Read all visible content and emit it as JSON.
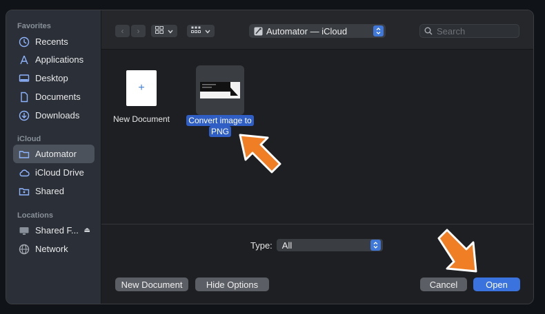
{
  "sidebar": {
    "sections": [
      {
        "title": "Favorites",
        "items": [
          {
            "label": "Recents",
            "icon": "clock-icon"
          },
          {
            "label": "Applications",
            "icon": "applications-icon"
          },
          {
            "label": "Desktop",
            "icon": "desktop-icon"
          },
          {
            "label": "Documents",
            "icon": "document-icon"
          },
          {
            "label": "Downloads",
            "icon": "downloads-icon"
          }
        ]
      },
      {
        "title": "iCloud",
        "items": [
          {
            "label": "Automator",
            "icon": "folder-icon",
            "selected": true
          },
          {
            "label": "iCloud Drive",
            "icon": "cloud-icon"
          },
          {
            "label": "Shared",
            "icon": "shared-folder-icon"
          }
        ]
      },
      {
        "title": "Locations",
        "items": [
          {
            "label": "Shared F...",
            "icon": "display-icon",
            "eject": "⏏"
          },
          {
            "label": "Network",
            "icon": "globe-icon"
          }
        ]
      }
    ]
  },
  "toolbar": {
    "back": "‹",
    "forward": "›",
    "path": "Automator — iCloud",
    "search_placeholder": "Search"
  },
  "files": [
    {
      "label": "New Document",
      "icon": "new-document-icon"
    },
    {
      "label_lines": [
        "Convert image to",
        "PNG"
      ],
      "icon": "workflow-thumbnail-icon",
      "selected": true
    }
  ],
  "type_filter": {
    "label": "Type:",
    "value": "All"
  },
  "footer": {
    "new_document": "New Document",
    "hide_options": "Hide Options",
    "cancel": "Cancel",
    "open": "Open"
  },
  "colors": {
    "accent": "#3a72de",
    "selection": "#2f5fc4",
    "annotation_arrow": "#f07e24"
  }
}
